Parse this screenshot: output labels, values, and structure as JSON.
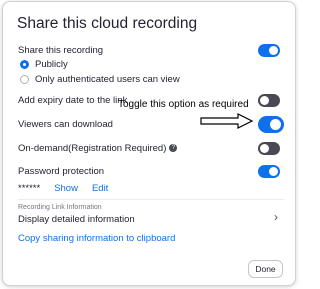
{
  "dialog": {
    "title": "Share this cloud recording",
    "share_label": "Share this recording",
    "share_enabled": true,
    "visibility_options": [
      {
        "label": "Publicly",
        "selected": true
      },
      {
        "label": "Only authenticated users can view",
        "selected": false
      }
    ],
    "expiry_label": "Add expiry date to the link",
    "expiry_enabled": false,
    "download_label": "Viewers can download",
    "download_enabled": true,
    "ondemand_label": "On-demand(Registration Required)",
    "ondemand_enabled": false,
    "password_label": "Password protection",
    "password_enabled": true,
    "password_mask": "******",
    "show_label": "Show",
    "edit_label": "Edit",
    "link_info_heading": "Recording Link Information",
    "detailed_info_label": "Display detailed information",
    "copy_label": "Copy sharing information to clipboard",
    "done_label": "Done"
  },
  "annotation": {
    "text": "Toggle this option as required"
  },
  "colors": {
    "accent": "#0e71eb",
    "toggle_off": "#4a4a55"
  },
  "icons": {
    "info": "info-icon",
    "chevron": "chevron-right-icon",
    "arrow": "right-arrow-icon"
  }
}
